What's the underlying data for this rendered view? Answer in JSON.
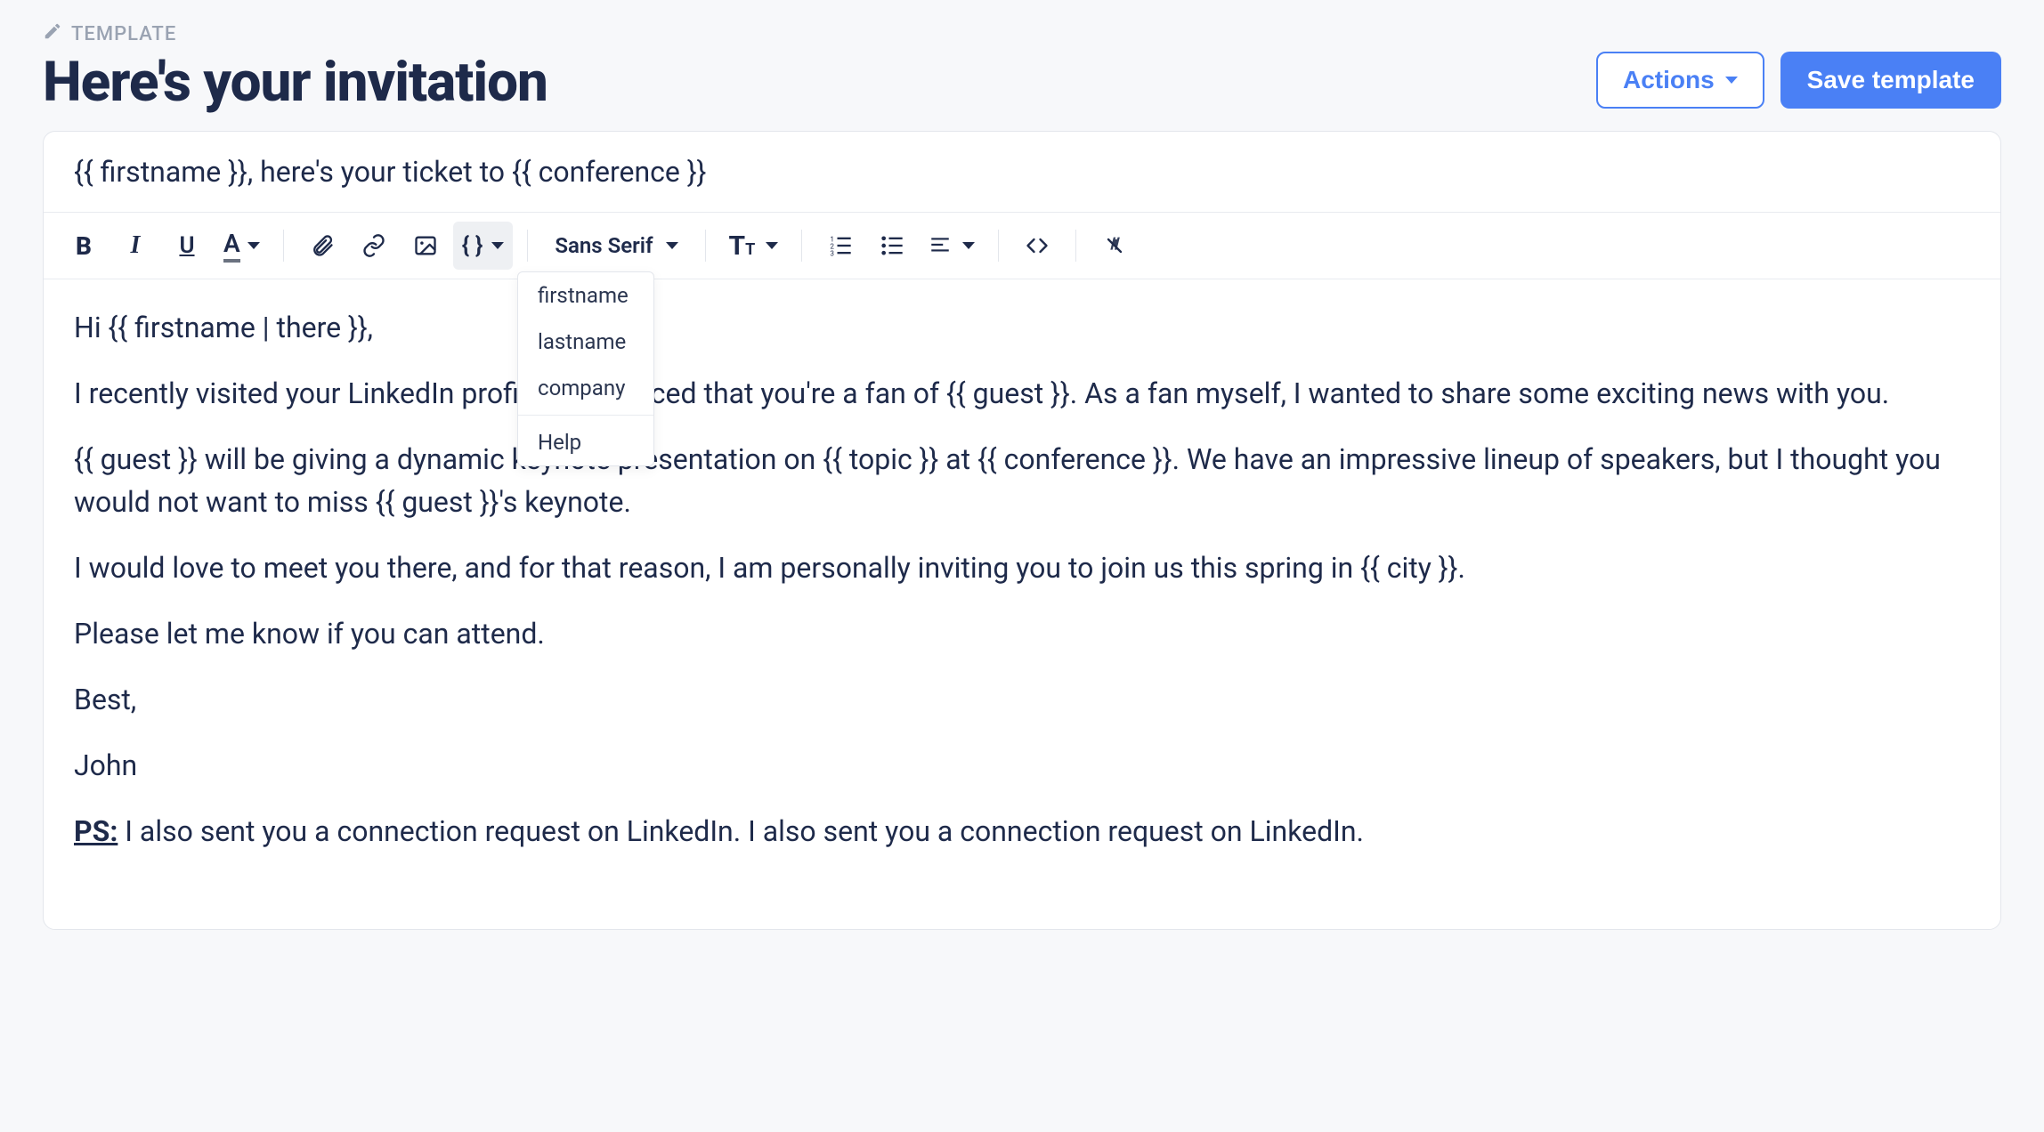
{
  "breadcrumb": {
    "label": "TEMPLATE"
  },
  "page_title": "Here's your invitation",
  "header_buttons": {
    "actions_label": "Actions",
    "save_label": "Save template"
  },
  "subject": "{{ firstname }}, here's your ticket to {{ conference }}",
  "toolbar": {
    "font_label": "Sans Serif"
  },
  "placeholder_menu": {
    "items": [
      "firstname",
      "lastname",
      "company"
    ],
    "help_label": "Help"
  },
  "body": {
    "greeting": "Hi {{ firstname | there }},",
    "p1": "I recently visited your LinkedIn profile and noticed that you're a fan of {{ guest }}. As a fan myself, I wanted to share some exciting news with you.",
    "p2": "{{ guest }} will be giving a dynamic keynote presentation on {{ topic }} at {{ conference }}. We have an impressive lineup of speakers, but I thought you would not want to miss {{ guest }}'s keynote.",
    "p3": "I would love to meet you there, and for that reason, I am personally inviting you to join us this spring in {{ city }}.",
    "p4": "Please let me know if you can attend.",
    "signoff": "Best,",
    "name": "John",
    "ps_label": "PS:",
    "ps_text": " I also sent you a connection request on LinkedIn. I also sent you a connection request on LinkedIn."
  }
}
